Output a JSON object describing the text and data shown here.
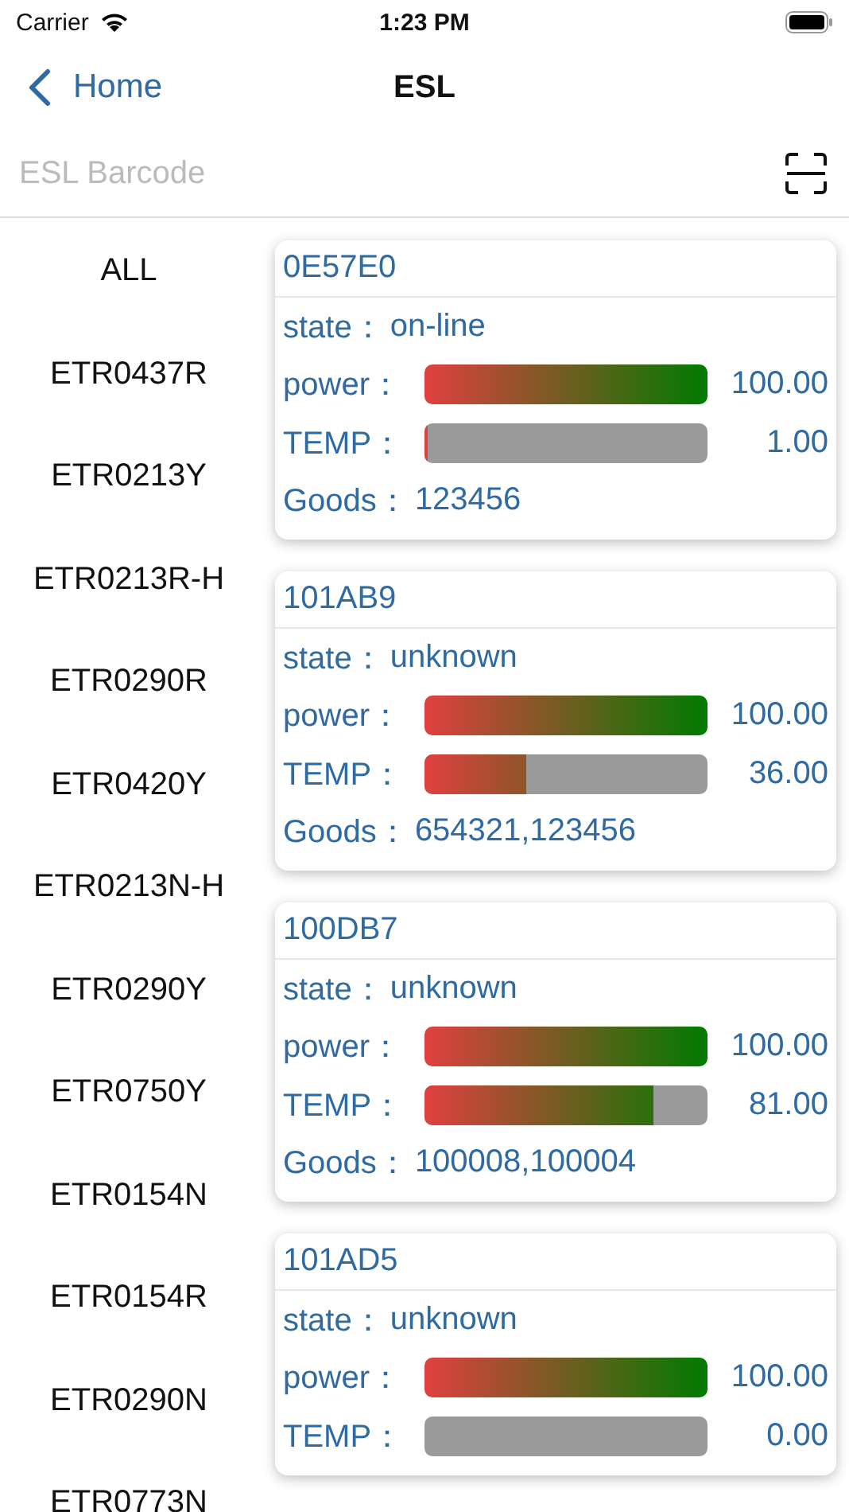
{
  "status_bar": {
    "carrier": "Carrier",
    "time": "1:23 PM"
  },
  "nav": {
    "back": "Home",
    "title": "ESL"
  },
  "search": {
    "placeholder": "ESL Barcode"
  },
  "categories": [
    {
      "label": "ALL"
    },
    {
      "label": "ETR0437R"
    },
    {
      "label": "ETR0213Y"
    },
    {
      "label": "ETR0213R-H"
    },
    {
      "label": "ETR0290R"
    },
    {
      "label": "ETR0420Y"
    },
    {
      "label": "ETR0213N-H"
    },
    {
      "label": "ETR0290Y"
    },
    {
      "label": "ETR0750Y"
    },
    {
      "label": "ETR0154N"
    },
    {
      "label": "ETR0154R"
    },
    {
      "label": "ETR0290N"
    },
    {
      "label": "ETR0773N"
    }
  ],
  "cards": [
    {
      "id": "0E57E0",
      "rows": [
        {
          "kind": "text",
          "label": "state：",
          "value": "on-line"
        },
        {
          "kind": "bar",
          "label": "power：",
          "level": 1,
          "reading": "100.00"
        },
        {
          "kind": "bar",
          "label": "TEMP：",
          "level": 0.01,
          "reading": "1.00"
        },
        {
          "kind": "text",
          "label": "Goods：",
          "value": "123456"
        }
      ]
    },
    {
      "id": "101AB9",
      "rows": [
        {
          "kind": "text",
          "label": "state：",
          "value": "unknown"
        },
        {
          "kind": "bar",
          "label": "power：",
          "level": 1,
          "reading": "100.00"
        },
        {
          "kind": "bar",
          "label": "TEMP：",
          "level": 0.36,
          "reading": "36.00"
        },
        {
          "kind": "text",
          "label": "Goods：",
          "value": "654321,123456"
        }
      ]
    },
    {
      "id": "100DB7",
      "rows": [
        {
          "kind": "text",
          "label": "state：",
          "value": "unknown"
        },
        {
          "kind": "bar",
          "label": "power：",
          "level": 1,
          "reading": "100.00"
        },
        {
          "kind": "bar",
          "label": "TEMP：",
          "level": 0.81,
          "reading": "81.00"
        },
        {
          "kind": "text",
          "label": "Goods：",
          "value": "100008,100004"
        }
      ]
    },
    {
      "id": "101AD5",
      "rows": [
        {
          "kind": "text",
          "label": "state：",
          "value": "unknown"
        },
        {
          "kind": "bar",
          "label": "power：",
          "level": 1,
          "reading": "100.00"
        },
        {
          "kind": "bar",
          "label": "TEMP：",
          "level": 0,
          "reading": "0.00"
        }
      ]
    }
  ]
}
